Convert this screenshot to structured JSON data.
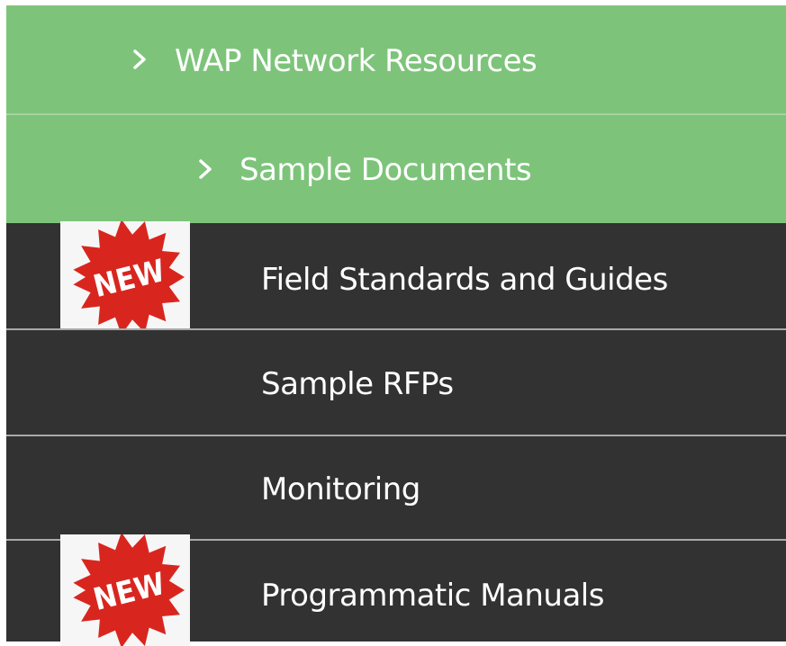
{
  "menu": {
    "items": [
      {
        "label": "WAP Network Resources",
        "icon": "chevron-right-icon",
        "level": 1,
        "color": "#7dc47a"
      },
      {
        "label": "Sample Documents",
        "icon": "chevron-right-icon",
        "level": 2,
        "color": "#7dc47a"
      },
      {
        "label": "Field Standards and Guides",
        "badge": "NEW",
        "level": 3,
        "color": "#323232"
      },
      {
        "label": "Sample RFPs",
        "level": 3,
        "color": "#323232"
      },
      {
        "label": "Monitoring",
        "level": 3,
        "color": "#323232"
      },
      {
        "label": "Programmatic Manuals",
        "badge": "NEW",
        "level": 3,
        "color": "#323232"
      }
    ],
    "badge_color": "#d8261f",
    "text_color": "#ffffff"
  }
}
